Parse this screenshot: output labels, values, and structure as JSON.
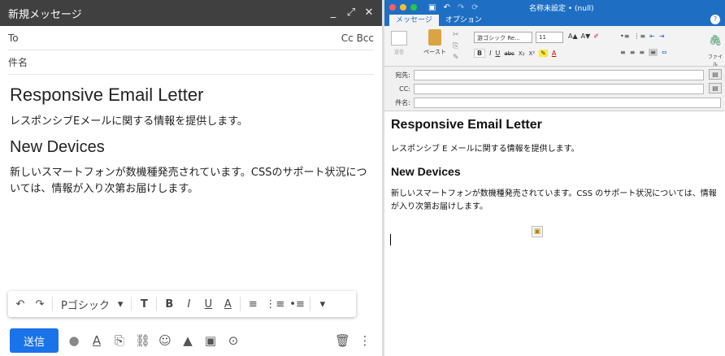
{
  "gmail": {
    "title": "新規メッセージ",
    "window_controls": {
      "minimize": "_",
      "expand": "⤢",
      "close": "✕"
    },
    "to_label": "To",
    "cc_bcc": "Cc Bcc",
    "subject_placeholder": "件名",
    "body": {
      "h1": "Responsive Email Letter",
      "p1": "レスポンシブEメールに関する情報を提供します。",
      "h2": "New Devices",
      "p2": "新しいスマートフォンが数機種発売されています。CSSのサポート状況については、情報が入り次第お届けします。"
    },
    "format_toolbar": {
      "undo": "↶",
      "redo": "↷",
      "font": "Pゴシック",
      "font_caret": "▾",
      "size": "T",
      "bold": "B",
      "italic": "I",
      "underline": "U",
      "text_color": "A",
      "align": "≡",
      "numbered": "⋮≡",
      "bulleted": "•≡",
      "more": "▾"
    },
    "send_label": "送信",
    "bottom_icons": [
      "●",
      "A",
      "⎘",
      "⛓",
      "☺",
      "▲",
      "▣",
      "⊙"
    ],
    "trash": "🗑",
    "more_menu": "⋮"
  },
  "outlook": {
    "title": "名称未設定 • (null)",
    "tabs": [
      {
        "label": "メッセージ"
      },
      {
        "label": "オプション"
      }
    ],
    "help": "?",
    "ribbon": {
      "send": "送信",
      "paste": "ペースト",
      "font_name": "游ゴシック Re...",
      "font_size": "11",
      "grow": "A▲",
      "shrink": "A▼",
      "bold": "B",
      "italic": "I",
      "underline": "U",
      "strike": "abc",
      "sub": "X₂",
      "sup": "X²",
      "attach": "ファイル\nを添付"
    },
    "fields": [
      {
        "label": "宛先:"
      },
      {
        "label": "CC:"
      },
      {
        "label": "件名:"
      }
    ],
    "body": {
      "h1": "Responsive Email Letter",
      "p1": "レスポンシブ E メールに関する情報を提供します。",
      "h2": "New Devices",
      "p2": "新しいスマートフォンが数機種発売されています。CSS のサポート状況については、情報が入り次第お届けします。"
    },
    "colors": {
      "title_bar": "#1e6fc4",
      "dot_red": "#ff5f57",
      "dot_yellow": "#febc2e",
      "dot_green": "#28c840"
    }
  }
}
